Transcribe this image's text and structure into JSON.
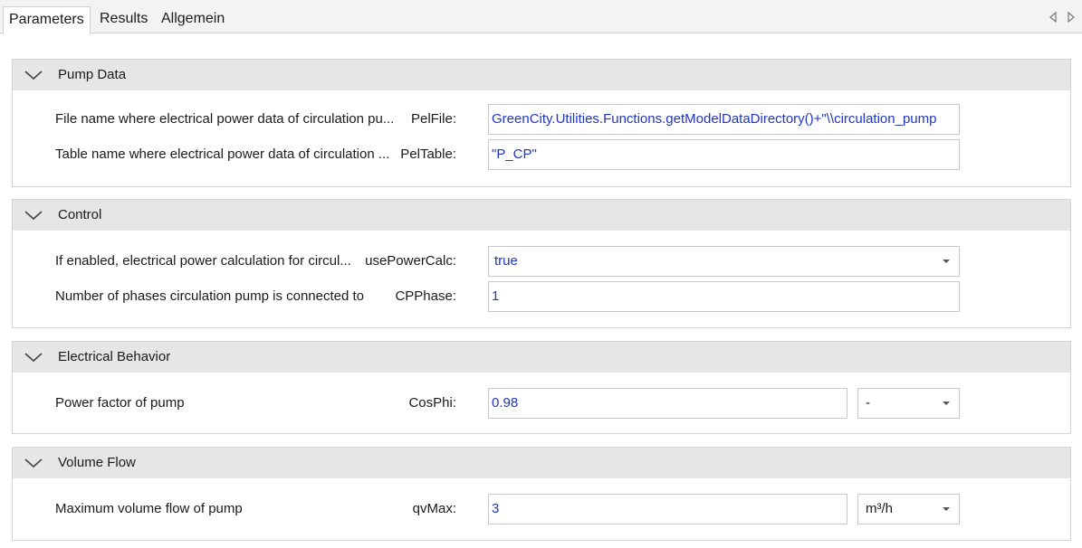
{
  "tabs": [
    {
      "label": "Parameters",
      "active": true
    },
    {
      "label": "Results",
      "active": false
    },
    {
      "label": "Allgemein",
      "active": false
    }
  ],
  "groups": [
    {
      "title": "Pump Data",
      "rows": [
        {
          "description": "File name where electrical power data of circulation pu...",
          "param": "PelFile:",
          "value": "GreenCity.Utilities.Functions.getModelDataDirectory()+\"\\\\circulation_pump"
        },
        {
          "description": "Table name where electrical power data of circulation ...",
          "param": "PelTable:",
          "value": "\"P_CP\""
        }
      ]
    },
    {
      "title": "Control",
      "rows": [
        {
          "description": "If enabled, electrical power calculation for circul...",
          "param": "usePowerCalc:",
          "value": "true"
        },
        {
          "description": "Number of phases circulation pump is connected to",
          "param": "CPPhase:",
          "value": "1"
        }
      ]
    },
    {
      "title": "Electrical Behavior",
      "rows": [
        {
          "description": "Power factor of pump",
          "param": "CosPhi:",
          "value": "0.98",
          "unit": "-"
        }
      ]
    },
    {
      "title": "Volume Flow",
      "rows": [
        {
          "description": "Maximum volume flow of pump",
          "param": "qvMax:",
          "value": "3",
          "unit": "m³/h"
        }
      ]
    }
  ],
  "icons": {
    "collapse": "chevron-down-icon",
    "nav_left": "triangle-left-icon",
    "nav_right": "triangle-right-icon"
  },
  "colors": {
    "value_text": "#1f35c4",
    "group_header": "#e6e6e6"
  }
}
